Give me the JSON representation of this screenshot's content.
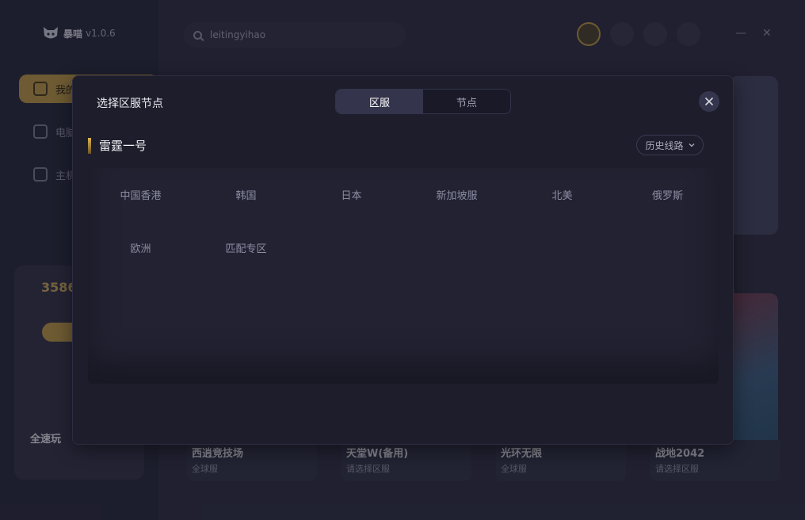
{
  "app": {
    "name": "暴喵",
    "version": "v1.0.6",
    "search_value": "leitingyihao",
    "nav": [
      "我的",
      "电脑",
      "主机"
    ],
    "promo_number": "3586",
    "promo_title": "全速玩",
    "games": [
      {
        "title": "西逍竞技场",
        "sub": "全球服"
      },
      {
        "title": "天堂W(备用)",
        "sub": "请选择区服"
      },
      {
        "title": "光环无限",
        "sub": "全球服"
      },
      {
        "title": "战地2042",
        "sub": "请选择区服"
      }
    ],
    "window_controls": {
      "minimize": "—",
      "close": "✕"
    }
  },
  "modal": {
    "title": "选择区服节点",
    "tabs": [
      {
        "label": "区服",
        "active": true
      },
      {
        "label": "节点",
        "active": false
      }
    ],
    "section_title": "雷霆一号",
    "history_label": "历史线路",
    "regions": [
      "中国香港",
      "韩国",
      "日本",
      "新加坡服",
      "北美",
      "俄罗斯",
      "欧洲",
      "匹配专区"
    ]
  },
  "colors": {
    "accent": "#b99544",
    "modal_bg": "#1d1d2b",
    "panel_bg": "#222232",
    "tab_active": "#34354c"
  }
}
